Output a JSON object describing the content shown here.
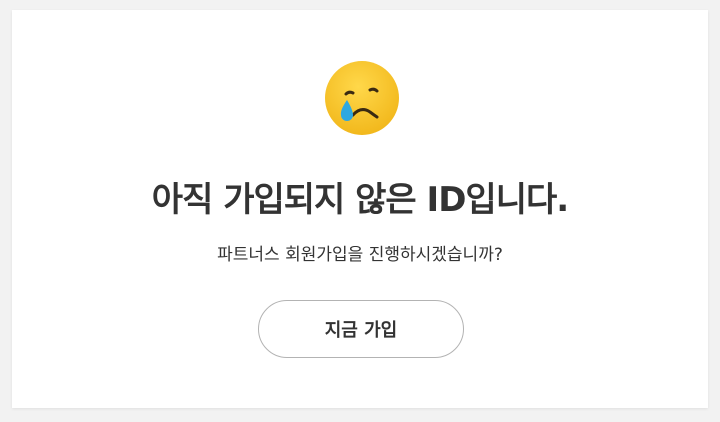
{
  "colors": {
    "background": "#f2f2f2",
    "card": "#ffffff",
    "text": "#333333",
    "button_border": "#b3b3b3",
    "emoji_face": "#f7c52a",
    "tear": "#2fa8e0"
  },
  "icon": "crying-face-icon",
  "title": "아직 가입되지 않은 ID입니다.",
  "subtitle": "파트너스 회원가입을 진행하시겠습니까?",
  "button": {
    "label": "지금 가입"
  }
}
